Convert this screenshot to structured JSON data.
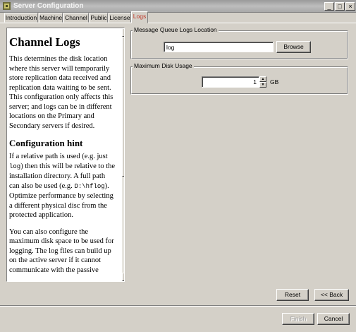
{
  "window": {
    "title": "Server Configuration",
    "minimize_glyph": "_",
    "maximize_glyph": "□",
    "close_glyph": "×"
  },
  "tabs": [
    {
      "label": "Introduction"
    },
    {
      "label": "Machine"
    },
    {
      "label": "Channel"
    },
    {
      "label": "Public"
    },
    {
      "label": "License"
    },
    {
      "label": "Logs",
      "active": true
    }
  ],
  "help": {
    "title": "Channel Logs",
    "intro": "This determines the disk location where this server will temporarily store replication data received and replication data waiting to be sent. This configuration only affects this server; and logs can be in different locations on the Primary and Secondary servers if desired.",
    "hint_heading": "Configuration hint",
    "hint_part1": "If a relative path is used (e.g. just ",
    "hint_code1": "log",
    "hint_part2": ") then this will be relative to the installation directory. A full path can also be used (e.g. ",
    "hint_code2": "D:\\hflog",
    "hint_part3": "). Optimize performance by selecting a different physical disc from the protected application.",
    "disk_para": "You can also configure the maximum disk space to be used for logging. The log files can build up on the active server if it cannot communicate with the passive"
  },
  "logs_location": {
    "legend": "Message Queue Logs Location",
    "value": "log",
    "browse_label": "Browse"
  },
  "disk_usage": {
    "legend": "Maximum Disk Usage",
    "value": "1",
    "unit": "GB"
  },
  "buttons": {
    "reset": "Reset",
    "back": "<< Back",
    "finish": "Finish",
    "cancel": "Cancel"
  }
}
